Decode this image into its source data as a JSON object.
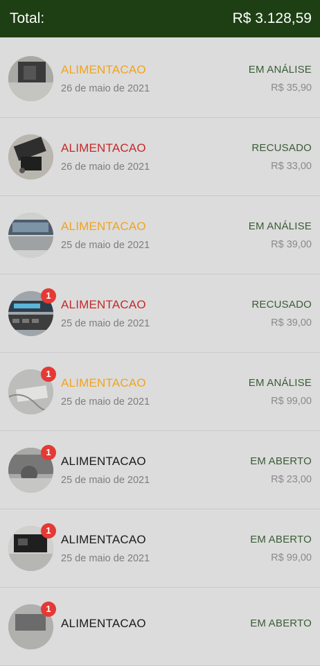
{
  "header": {
    "total_label": "Total:",
    "total_value": "R$ 3.128,59"
  },
  "colors": {
    "header_bg": "#1e3f14",
    "category_orange": "#f1a31c",
    "category_red": "#c62828",
    "category_black": "#1a1a1a",
    "badge": "#e53935",
    "status_text": "#3a5b36"
  },
  "items": [
    {
      "category": "ALIMENTACAO",
      "category_color": "orange",
      "date": "26 de maio de 2021",
      "status": "EM ANÁLISE",
      "amount": "R$ 35,90",
      "badge": null
    },
    {
      "category": "ALIMENTACAO",
      "category_color": "red",
      "date": "26 de maio de 2021",
      "status": "RECUSADO",
      "amount": "R$ 33,00",
      "badge": null
    },
    {
      "category": "ALIMENTACAO",
      "category_color": "orange",
      "date": "25 de maio de 2021",
      "status": "EM ANÁLISE",
      "amount": "R$ 39,00",
      "badge": null
    },
    {
      "category": "ALIMENTACAO",
      "category_color": "red",
      "date": "25 de maio de 2021",
      "status": "RECUSADO",
      "amount": "R$ 39,00",
      "badge": "1"
    },
    {
      "category": "ALIMENTACAO",
      "category_color": "orange",
      "date": "25 de maio de 2021",
      "status": "EM ANÁLISE",
      "amount": "R$ 99,00",
      "badge": "1"
    },
    {
      "category": "ALIMENTACAO",
      "category_color": "black",
      "date": "25 de maio de 2021",
      "status": "EM ABERTO",
      "amount": "R$ 23,00",
      "badge": "1"
    },
    {
      "category": "ALIMENTACAO",
      "category_color": "black",
      "date": "25 de maio de 2021",
      "status": "EM ABERTO",
      "amount": "R$ 99,00",
      "badge": "1"
    },
    {
      "category": "ALIMENTACAO",
      "category_color": "black",
      "date": "",
      "status": "EM ABERTO",
      "amount": "",
      "badge": "1"
    }
  ]
}
